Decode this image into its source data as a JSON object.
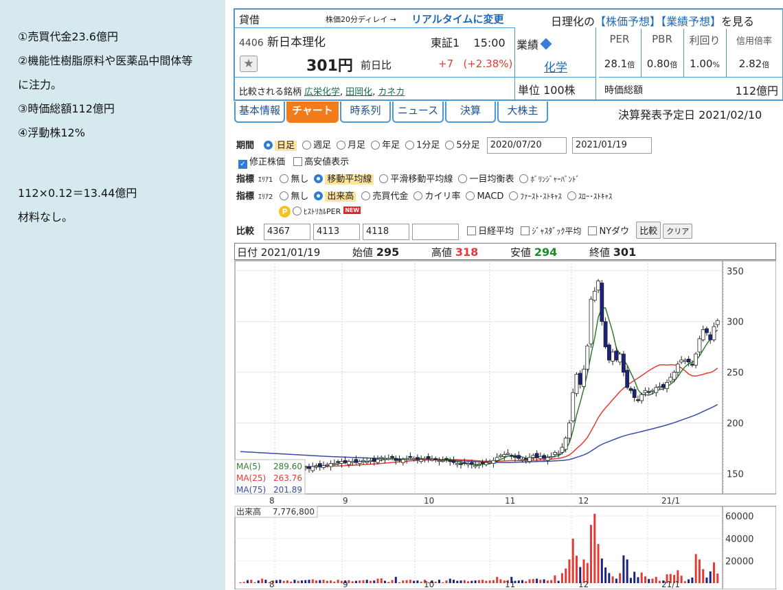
{
  "notes": {
    "line1": "①売買代金23.6億円",
    "line2": "②機能性樹脂原料や医薬品中間体等",
    "line3": "に注力。",
    "line4": "③時価総額112億円",
    "line5": "④浮動株12%",
    "line6": "112×0.12＝13.44億円",
    "line7": "材料なし。"
  },
  "header": {
    "kashaku": "貸借",
    "delay": "株価20分ディレイ →",
    "realtime": "リアルタイムに変更",
    "nikkei_pre": "日理化の",
    "kabuka_yoso": "【株価予想】",
    "gyoseki_yoso": "【業績予想】",
    "nikkei_post": "を見る",
    "code": "4406",
    "name": "新日本理化",
    "exchange": "東証1",
    "time": "15:00",
    "price": "301円",
    "prev_label": "前日比",
    "change": "+7",
    "change_pct": "(+2.38%)",
    "compare_label": "比較される銘柄",
    "compare": [
      "広栄化学",
      "田岡化",
      "カネカ"
    ],
    "gyoseki": "業績",
    "sector": "化学",
    "unit": "単位 100株"
  },
  "metrics": {
    "per_h": "PER",
    "pbr_h": "PBR",
    "yield_h": "利回り",
    "margin_h": "信用倍率",
    "per": "28.1",
    "pbr": "0.80",
    "yield": "1.00",
    "margin": "2.82",
    "bai": "倍",
    "pct": "%",
    "mcap_label": "時価総額",
    "mcap": "112億円"
  },
  "tabs": [
    "基本情報",
    "チャート",
    "時系列",
    "ニュース",
    "決算",
    "大株主"
  ],
  "kessan_date": "決算発表予定日 2021/02/10",
  "form": {
    "kikan": "期間",
    "periods": [
      "日足",
      "週足",
      "月足",
      "年足",
      "1分足",
      "5分足"
    ],
    "date_from": "2020/07/20",
    "date_to": "2021/01/19",
    "adjusted": "修正株価",
    "hi_lo": "高安値表示",
    "shihyo": "指標",
    "area1": "ｴﾘｱ1",
    "area2": "ｴﾘｱ2",
    "ind1": [
      "無し",
      "移動平均線",
      "平滑移動平均線",
      "一目均衡表",
      "ﾎﾞﾘﾝｼﾞｬｰﾊﾞﾝﾄﾞ"
    ],
    "ind2": [
      "無し",
      "出来高",
      "売買代金",
      "カイリ率",
      "MACD",
      "ﾌｧｰｽﾄ･ｽﾄｷｬｽ",
      "ｽﾛｰ･ｽﾄｷｬｽ"
    ],
    "hist_per": "ﾋｽﾄﾘｶﾙPER",
    "new": "NEW",
    "p": "P",
    "hikaku": "比較",
    "codes": [
      "4367",
      "4113",
      "4118",
      ""
    ],
    "nikkei_avg": "日経平均",
    "jasdaq": "ｼﾞｬｽﾀﾞｯｸ平均",
    "nydow": "NYダウ",
    "compare_btn": "比較",
    "clear_btn": "クリア"
  },
  "ohlc_bar": {
    "date_label": "日付",
    "date": "2021/01/19",
    "open_label": "始値",
    "open": "295",
    "high_label": "高値",
    "high": "318",
    "low_label": "安値",
    "low": "294",
    "close_label": "終値",
    "close": "301"
  },
  "colors": {
    "ma5": "#2e7d32",
    "ma25": "#e53935",
    "ma75": "#3949ab",
    "up": "#e53935",
    "down": "#1a237e",
    "accent": "#4a98d6",
    "tab_active": "#f27b1a"
  },
  "chart_data": [
    {
      "type": "candlestick",
      "ylim": [
        130,
        360
      ],
      "yticks": [
        150,
        200,
        250,
        300,
        350
      ],
      "xticks": [
        "8",
        "9",
        "10",
        "11",
        "12",
        "21/1"
      ],
      "legend": [
        {
          "name": "MA(5)",
          "value": "289.60"
        },
        {
          "name": "MA(25)",
          "value": "263.76"
        },
        {
          "name": "MA(75)",
          "value": "201.89"
        }
      ],
      "close": [
        157,
        157,
        156,
        157,
        157,
        156,
        158,
        157,
        157,
        158,
        157,
        156,
        157,
        158,
        158,
        157,
        158,
        157,
        156,
        155,
        157,
        158,
        157,
        158,
        159,
        160,
        160,
        161,
        162,
        161,
        162,
        162,
        161,
        162,
        163,
        162,
        163,
        162,
        164,
        166,
        165,
        165,
        166,
        163,
        163,
        164,
        165,
        166,
        165,
        164,
        164,
        165,
        165,
        164,
        164,
        163,
        163,
        164,
        162,
        161,
        160,
        159,
        160,
        160,
        159,
        158,
        159,
        160,
        161,
        162,
        163,
        166,
        168,
        169,
        170,
        167,
        166,
        165,
        164,
        164,
        166,
        168,
        166,
        167,
        165,
        166,
        167,
        171,
        170,
        176,
        185,
        200,
        230,
        248,
        238,
        253,
        276,
        322,
        330,
        340,
        300,
        275,
        262,
        270,
        262,
        268,
        250,
        235,
        232,
        225,
        222,
        228,
        232,
        230,
        232,
        235,
        236,
        235,
        240,
        245,
        250,
        258,
        262,
        262,
        260,
        257,
        268,
        283,
        292,
        289,
        282,
        295,
        301
      ],
      "ma5_end": 289.6,
      "ma25_end": 263.76,
      "ma75_end": 201.89
    },
    {
      "type": "bar",
      "title": "出来高",
      "last_value": "7,776,800",
      "ylim": [
        0,
        65000
      ],
      "yticks": [
        20000,
        40000,
        60000
      ]
    }
  ]
}
